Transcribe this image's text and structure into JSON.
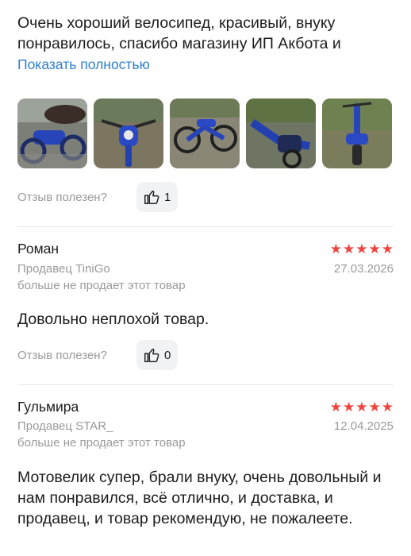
{
  "review1": {
    "text": "Очень хороший велосипед, красивый, внуку понравилось, спасибо магазину ИП Акбота и",
    "show_more": "Показать полностью",
    "photos": [
      "bike-photo-1",
      "bike-photo-2",
      "bike-photo-3",
      "bike-photo-4",
      "bike-photo-5"
    ],
    "helpful_label": "Отзыв полезен?",
    "likes": "1"
  },
  "review2": {
    "author": "Роман",
    "rating": 5,
    "seller": "Продавец TiniGo",
    "seller_note": "больше не продает этот товар",
    "date": "27.03.2026",
    "text": "Довольно неплохой товар.",
    "helpful_label": "Отзыв полезен?",
    "likes": "0"
  },
  "review3": {
    "author": "Гульмира",
    "rating": 5,
    "seller": "Продавец STAR_",
    "seller_note": "больше не продает этот товар",
    "date": "12.04.2025",
    "text": "Мотовелик супер, брали внуку, очень довольный и нам понравился, всё отлично, и доставка, и продавец, и товар рекомендую, не пожалеете."
  },
  "colors": {
    "accent_link": "#2f7fd0",
    "star": "#f0443f",
    "muted": "#9a9a9a"
  },
  "icons": {
    "like": "thumbs-up-icon",
    "star": "star-icon"
  }
}
